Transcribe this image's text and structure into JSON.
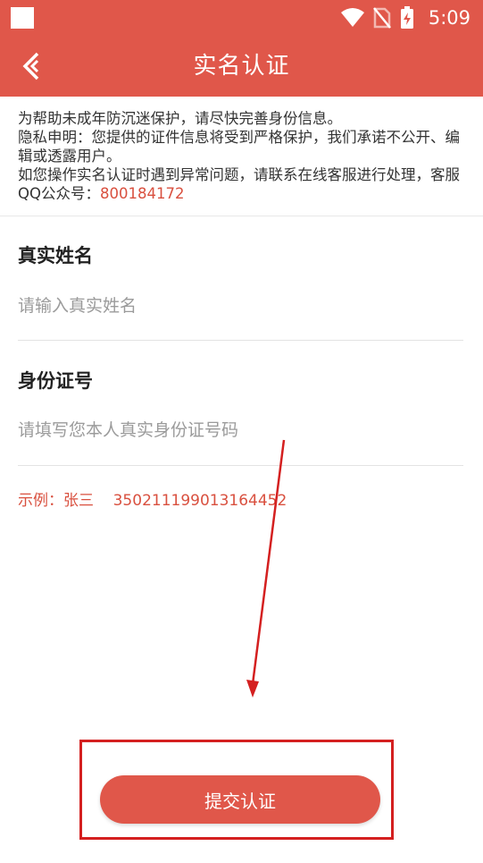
{
  "status_bar": {
    "time": "5:09",
    "icons": [
      "wifi-icon",
      "no-sim-icon",
      "battery-charging-icon"
    ]
  },
  "header": {
    "title": "实名认证",
    "back_icon": "chevron-left-icon"
  },
  "notice": {
    "line1": "为帮助未成年防沉迷保护，请尽快完善身份信息。",
    "line2": "隐私申明：您提供的证件信息将受到严格保护，我们承诺不公开、编辑或透露用户。",
    "line3_prefix": "如您操作实名认证时遇到异常问题，请联系在线客服进行处理，客服QQ公众号：",
    "qq_number": "800184172"
  },
  "form": {
    "name_label": "真实姓名",
    "name_placeholder": "请输入真实姓名",
    "id_label": "身份证号",
    "id_placeholder": "请填写您本人真实身份证号码",
    "example": "示例：张三    350211199013164452"
  },
  "submit": {
    "label": "提交认证"
  },
  "colors": {
    "accent": "#e0574a",
    "highlight": "#d9503f",
    "annotation": "#d42020"
  }
}
